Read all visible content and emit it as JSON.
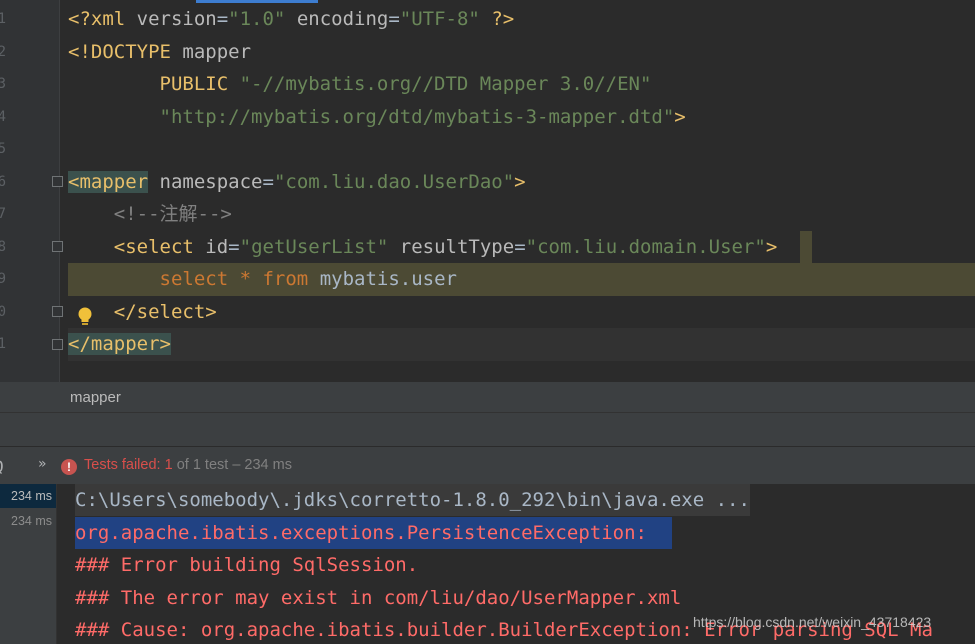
{
  "editor": {
    "line_numbers": [
      "1",
      "2",
      "3",
      "4",
      "5",
      "6",
      "7",
      "8",
      "9",
      "0",
      "1"
    ],
    "lines": {
      "l1": {
        "open": "<?xml ",
        "a1": "version",
        "eq1": "=",
        "v1": "\"1.0\"",
        "sp": " ",
        "a2": "encoding",
        "eq2": "=",
        "v2": "\"UTF-8\"",
        "close": " ?>"
      },
      "l2": {
        "open": "<!DOCTYPE ",
        "name": "mapper"
      },
      "l3": {
        "indent": "        ",
        "kw": "PUBLIC ",
        "val": "\"-//mybatis.org//DTD Mapper 3.0//EN\""
      },
      "l4": {
        "indent": "        ",
        "val": "\"http://mybatis.org/dtd/mybatis-3-mapper.dtd\"",
        "close": ">"
      },
      "l6": {
        "open": "<mapper",
        "sp": " ",
        "attr": "namespace",
        "eq": "=",
        "val": "\"com.liu.dao.UserDao\"",
        "close": ">"
      },
      "l7": {
        "indent": "    ",
        "comment": "<!--注解-->"
      },
      "l8": {
        "indent": "    ",
        "open": "<select",
        "a1": " id",
        "eq1": "=",
        "v1": "\"getUserList\"",
        "a2": " resultType",
        "eq2": "=",
        "v2": "\"com.liu.domain.User\"",
        "close": ">"
      },
      "l9": {
        "indent": "        ",
        "k1": "select ",
        "star": "*",
        "k2": " from",
        "rest": " mybatis.user"
      },
      "l10": {
        "indent": "    ",
        "close": "</select>"
      },
      "l11": {
        "close": "</mapper>"
      }
    }
  },
  "breadcrumb": {
    "label": "mapper"
  },
  "run": {
    "status_prefix": "Tests failed: ",
    "failed_count": "1",
    "status_rest": " of 1 test – 234 ms",
    "error_glyph": "!",
    "chevrons": "»",
    "search_glyph": "Q",
    "tree_items": [
      "234 ms",
      "234 ms"
    ]
  },
  "console": {
    "lines": [
      "C:\\Users\\somebody\\.jdks\\corretto-1.8.0_292\\bin\\java.exe ...",
      "org.apache.ibatis.exceptions.PersistenceException: ",
      "### Error building SqlSession.",
      "### The error may exist in com/liu/dao/UserMapper.xml",
      "### Cause: org.apache.ibatis.builder.BuilderException: Error parsing SQL Ma"
    ]
  },
  "watermark": {
    "text": "https://blog.csdn.net/weixin_43718423"
  },
  "colors": {
    "tag": "#e8bf6a",
    "attribute": "#bababa",
    "string": "#6a8759",
    "keyword": "#cc7832",
    "error_text": "#ff6b68",
    "selection": "#214283",
    "failed_status": "#d94f4b"
  }
}
